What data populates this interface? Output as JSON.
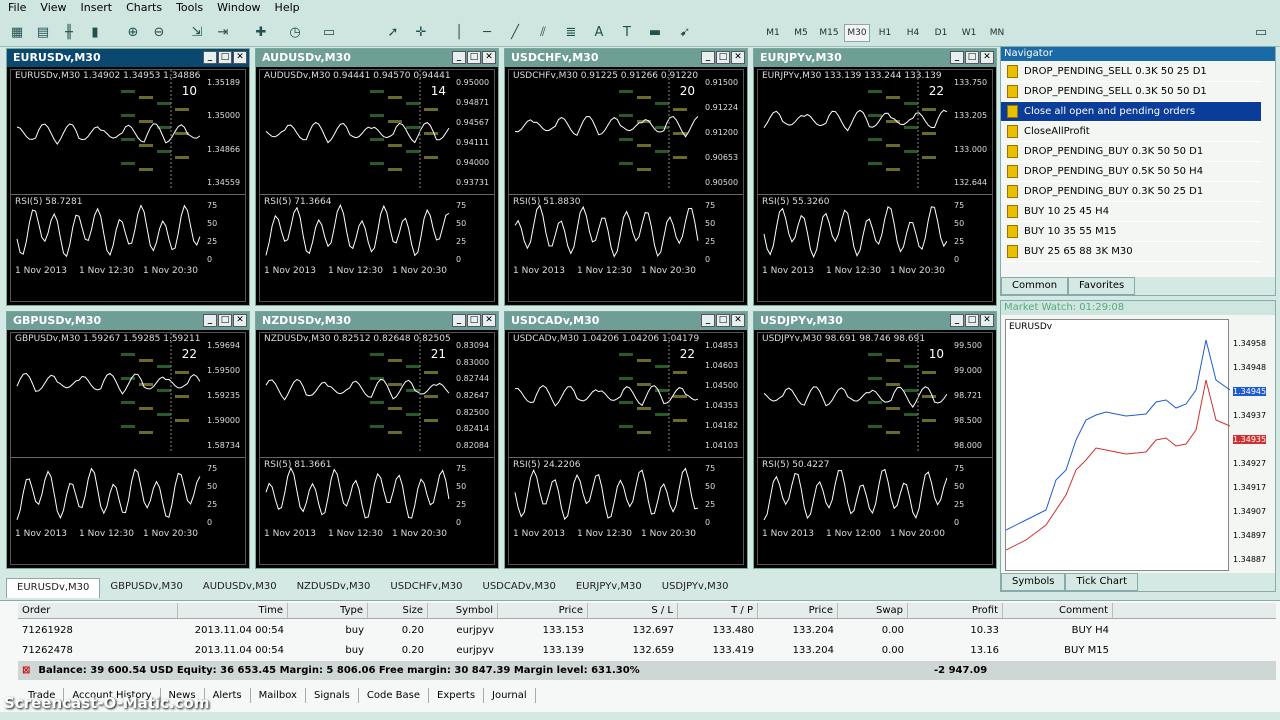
{
  "menu": [
    "File",
    "View",
    "Insert",
    "Charts",
    "Tools",
    "Window",
    "Help"
  ],
  "timeframes": [
    "M1",
    "M5",
    "M15",
    "M30",
    "H1",
    "H4",
    "D1",
    "W1",
    "MN"
  ],
  "active_timeframe": "M30",
  "charts": [
    {
      "title": "EURUSDv,M30",
      "info": "EURUSDv,M30  1.34902 1.34953 1.34886",
      "num": "10",
      "prices": [
        "1.35189",
        "1.35000",
        "1.34866",
        "1.34559"
      ],
      "rsi": "RSI(5) 58.7281",
      "dates": [
        "1 Nov 2013",
        "1 Nov 12:30",
        "1 Nov 20:30"
      ],
      "active": true
    },
    {
      "title": "AUDUSDv,M30",
      "info": "AUDUSDv,M30  0.94441 0.94570 0.94441",
      "num": "14",
      "prices": [
        "0.95000",
        "0.94871",
        "0.94567",
        "0.94111",
        "0.94000",
        "0.93731"
      ],
      "rsi": "RSI(5) 71.3664",
      "dates": [
        "1 Nov 2013",
        "1 Nov 12:30",
        "1 Nov 20:30"
      ]
    },
    {
      "title": "USDCHFv,M30",
      "info": "USDCHFv,M30  0.91225 0.91266 0.91220",
      "num": "20",
      "prices": [
        "0.91500",
        "0.91224",
        "0.91200",
        "0.90653",
        "0.90500"
      ],
      "rsi": "RSI(5) 51.8830",
      "dates": [
        "1 Nov 2013",
        "1 Nov 12:30",
        "1 Nov 20:30"
      ]
    },
    {
      "title": "EURJPYv,M30",
      "info": "EURJPYv,M30  133.139 133.244 133.139",
      "num": "22",
      "prices": [
        "133.750",
        "133.205",
        "133.000",
        "132.644"
      ],
      "rsi": "RSI(5) 55.3260",
      "dates": [
        "1 Nov 2013",
        "1 Nov 12:30",
        "1 Nov 20:30"
      ]
    },
    {
      "title": "GBPUSDv,M30",
      "info": "GBPUSDv,M30  1.59267 1.59285 1.59211",
      "num": "22",
      "prices": [
        "1.59694",
        "1.59500",
        "1.59235",
        "1.59000",
        "1.58734"
      ],
      "rsi": "",
      "dates": [
        "1 Nov 2013",
        "1 Nov 12:30",
        "1 Nov 20:30"
      ]
    },
    {
      "title": "NZDUSDv,M30",
      "info": "NZDUSDv,M30  0.82512 0.82648 0.82505",
      "num": "21",
      "prices": [
        "0.83094",
        "0.83000",
        "0.82744",
        "0.82647",
        "0.82500",
        "0.82414",
        "0.82084"
      ],
      "rsi": "RSI(5) 81.3661",
      "dates": [
        "1 Nov 2013",
        "1 Nov 12:30",
        "1 Nov 20:30"
      ]
    },
    {
      "title": "USDCADv,M30",
      "info": "USDCADv,M30  1.04206 1.04206 1.04179",
      "num": "22",
      "prices": [
        "1.04853",
        "1.04603",
        "1.04500",
        "1.04353",
        "1.04182",
        "1.04103"
      ],
      "rsi": "RSI(5) 24.2206",
      "dates": [
        "1 Nov 2013",
        "1 Nov 12:30",
        "1 Nov 20:30"
      ]
    },
    {
      "title": "USDJPYv,M30",
      "info": "USDJPYv,M30  98.691 98.746 98.691",
      "num": "10",
      "prices": [
        "99.500",
        "99.000",
        "98.721",
        "98.500",
        "98.000"
      ],
      "rsi": "RSI(5) 50.4227",
      "dates": [
        "1 Nov 2013",
        "1 Nov 12:00",
        "1 Nov 20:00"
      ]
    }
  ],
  "navigator": {
    "title": "Navigator",
    "items": [
      "DROP_PENDING_SELL  0.3K 50 25  D1",
      "DROP_PENDING_SELL  0.3K 50 50  D1",
      "Close all open and pending orders",
      "CloseAllProfit",
      "DROP_PENDING_BUY  0.3K 50 50  D1",
      "DROP_PENDING_BUY  0.5K 50 50  H4",
      "DROP_PENDING_BUY  0.3K 50 25  D1",
      "BUY  10  25   45  H4",
      "BUY  10  35   55  M15",
      "BUY  25 65 88  3K  M30"
    ],
    "tabs": [
      "Common",
      "Favorites"
    ]
  },
  "market_watch": {
    "title": "Market Watch: 01:29:08",
    "symbol": "EURUSDv",
    "axis": [
      "1.34958",
      "1.34948",
      "1.34945",
      "1.34937",
      "1.34935",
      "1.34927",
      "1.34917",
      "1.34907",
      "1.34897",
      "1.34887"
    ],
    "tabs": [
      "Symbols",
      "Tick Chart"
    ]
  },
  "chart_tabs": [
    "EURUSDv,M30",
    "GBPUSDv,M30",
    "AUDUSDv,M30",
    "NZDUSDv,M30",
    "USDCHFv,M30",
    "USDCADv,M30",
    "EURJPYv,M30",
    "USDJPYv,M30"
  ],
  "terminal": {
    "headers": [
      "Order",
      "Time",
      "Type",
      "Size",
      "Symbol",
      "Price",
      "S / L",
      "T / P",
      "Price",
      "Swap",
      "Profit",
      "Comment"
    ],
    "rows": [
      [
        "71261928",
        "2013.11.04 00:54",
        "buy",
        "0.20",
        "eurjpyv",
        "133.153",
        "132.697",
        "133.480",
        "133.204",
        "0.00",
        "10.33",
        "BUY H4"
      ],
      [
        "71262478",
        "2013.11.04 00:54",
        "buy",
        "0.20",
        "eurjpyv",
        "133.139",
        "132.659",
        "133.419",
        "133.204",
        "0.00",
        "13.16",
        "BUY M15"
      ]
    ],
    "balance": "Balance: 39 600.54 USD  Equity: 36 653.45  Margin: 5 806.06  Free margin: 30 847.39  Margin level: 631.30%",
    "balance_profit": "-2 947.09",
    "tabs": [
      "Trade",
      "Account History",
      "News",
      "Alerts",
      "Mailbox",
      "Signals",
      "Code Base",
      "Experts",
      "Journal"
    ]
  },
  "watermark": "Screencast-O-Matic.com"
}
